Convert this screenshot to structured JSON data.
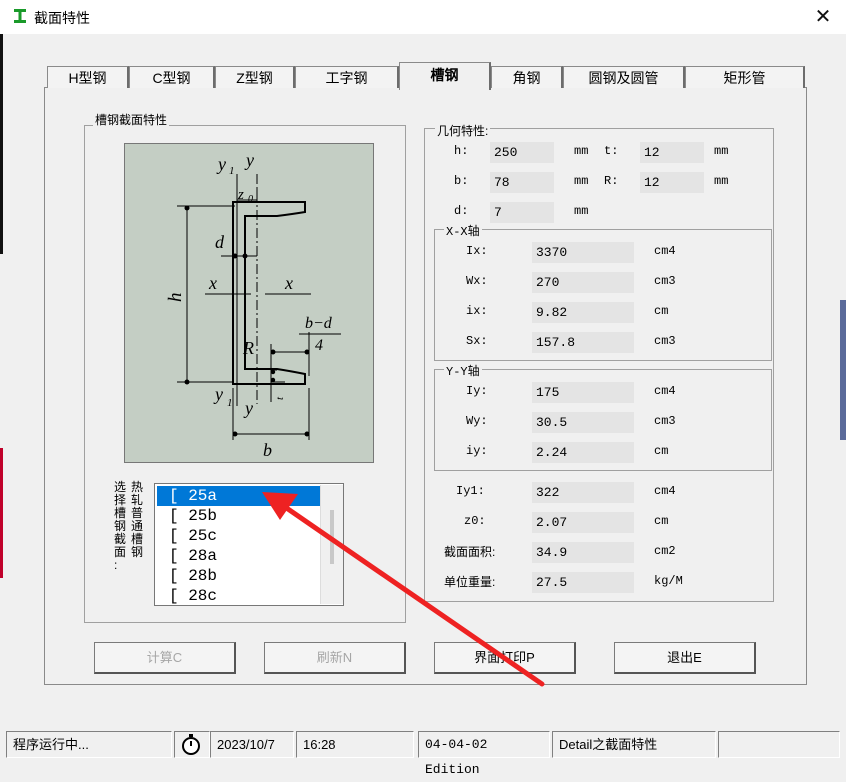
{
  "window": {
    "title": "截面特性",
    "close_glyph": "✕"
  },
  "tabs": [
    {
      "label": "H型钢"
    },
    {
      "label": "C型钢"
    },
    {
      "label": "Z型钢"
    },
    {
      "label": "工字钢"
    },
    {
      "label": "槽钢",
      "active": true
    },
    {
      "label": "角钢"
    },
    {
      "label": "圆钢及圆管"
    },
    {
      "label": "矩形管"
    }
  ],
  "section_group": {
    "title": "槽钢截面特性"
  },
  "figure_labels": {
    "y1_top": "y",
    "y1_sub": "1",
    "y_top": "y",
    "z0": "z",
    "z0_sub": "0",
    "d": "d",
    "h": "h",
    "x_left": "x",
    "x_right": "x",
    "bd4_top": "b−d",
    "bd4_bottom": "4",
    "R": "R",
    "y1_bottom": "y",
    "y1_bottom_sub": "1",
    "y_bottom": "y",
    "t": "t",
    "b": "b"
  },
  "list": {
    "label_col1": [
      "热",
      "轧",
      "普",
      "通",
      "槽",
      "钢"
    ],
    "label_col2": [
      "选",
      "择",
      "槽",
      "钢",
      "截",
      "面",
      ":"
    ],
    "items": [
      "[ 25a",
      "[ 25b",
      "[ 25c",
      "[ 28a",
      "[ 28b",
      "[ 28c"
    ],
    "selected_index": 0
  },
  "geometry": {
    "title": "几何特性:",
    "h": {
      "label": "h:",
      "value": "250",
      "unit": "mm"
    },
    "t": {
      "label": "t:",
      "value": "12",
      "unit": "mm"
    },
    "b": {
      "label": "b:",
      "value": "78",
      "unit": "mm"
    },
    "R": {
      "label": "R:",
      "value": "12",
      "unit": "mm"
    },
    "d": {
      "label": "d:",
      "value": "7",
      "unit": "mm"
    }
  },
  "xx_axis": {
    "title": "X-X轴",
    "Ix": {
      "label": "Ix:",
      "value": "3370",
      "unit": "cm4"
    },
    "Wx": {
      "label": "Wx:",
      "value": "270",
      "unit": "cm3"
    },
    "ix": {
      "label": "ix:",
      "value": "9.82",
      "unit": "cm"
    },
    "Sx": {
      "label": "Sx:",
      "value": "157.8",
      "unit": "cm3"
    }
  },
  "yy_axis": {
    "title": "Y-Y轴",
    "Iy": {
      "label": "Iy:",
      "value": "175",
      "unit": "cm4"
    },
    "Wy": {
      "label": "Wy:",
      "value": "30.5",
      "unit": "cm3"
    },
    "iy": {
      "label": "iy:",
      "value": "2.24",
      "unit": "cm"
    }
  },
  "other": {
    "Iy1": {
      "label": "Iy1:",
      "value": "322",
      "unit": "cm4"
    },
    "z0": {
      "label": "z0:",
      "value": "2.07",
      "unit": "cm"
    },
    "area": {
      "label": "截面面积:",
      "value": "34.9",
      "unit": "cm2"
    },
    "weight": {
      "label": "单位重量:",
      "value": "27.5",
      "unit": "kg/M"
    }
  },
  "buttons": {
    "calc": "计算C",
    "refresh": "刷新N",
    "print": "界面打印P",
    "exit": "退出E"
  },
  "statusbar": {
    "status": "程序运行中...",
    "date": "2023/10/7",
    "time": "16:28",
    "edition": "04-04-02 Edition",
    "detail": "Detail之截面特性"
  },
  "colors": {
    "selection": "#0078d7",
    "arrow": "#ee2222",
    "figure_bg": "#c4cec4"
  }
}
